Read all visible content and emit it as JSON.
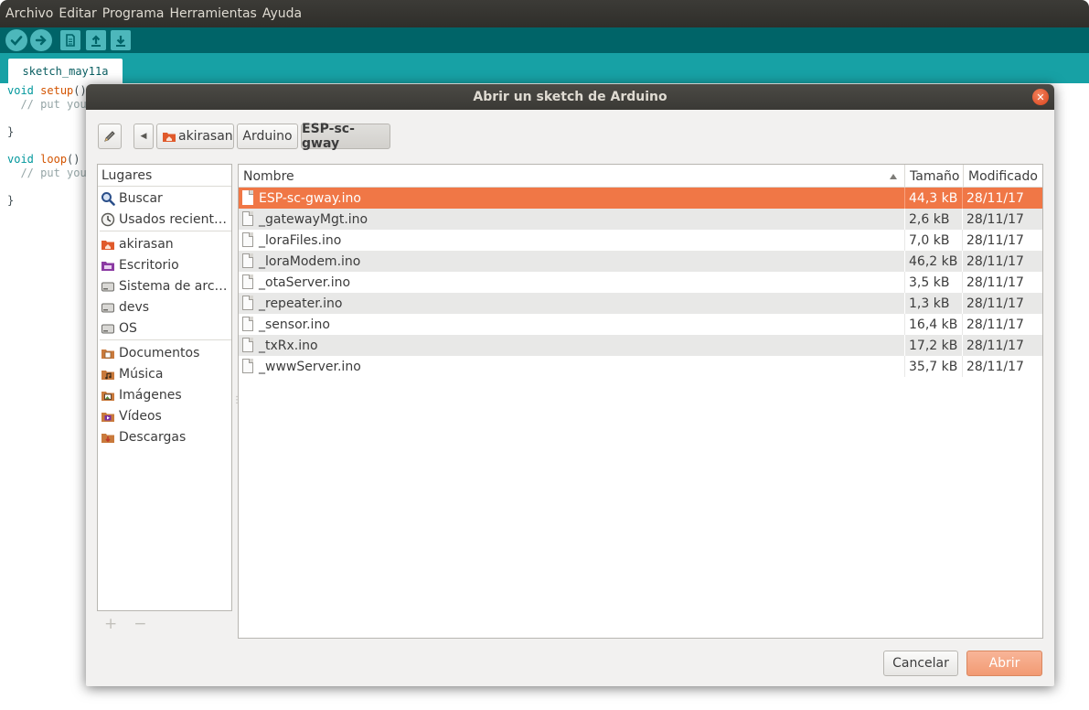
{
  "ide": {
    "menu": [
      "Archivo",
      "Editar",
      "Programa",
      "Herramientas",
      "Ayuda"
    ],
    "toolbar": {
      "verify_icon": "check-icon",
      "upload_icon": "arrow-right-icon",
      "new_icon": "new-file-icon",
      "open_icon": "arrow-up-icon",
      "save_icon": "arrow-down-icon"
    },
    "tab_label": "sketch_may11a",
    "code": {
      "l1_kw": "void",
      "l1_fn": "setup",
      "l1_rest": "()",
      "l2": "  // put you",
      "l3": "}",
      "l5_kw": "void",
      "l5_fn": "loop",
      "l5_rest": "() {",
      "l6": "  // put you",
      "l7": "}"
    },
    "colors": {
      "toolbar": "#006468",
      "tabbar": "#17a1a5"
    }
  },
  "dialog": {
    "title": "Abrir un sketch de Arduino",
    "close_icon": "close-icon",
    "path_edit_icon": "pencil-icon",
    "back_icon": "chevron-left-icon",
    "breadcrumbs": [
      "akirasan",
      "Arduino",
      "ESP-sc-gway"
    ],
    "places": {
      "header": "Lugares",
      "items": [
        {
          "label": "Buscar",
          "icon": "search-icon"
        },
        {
          "label": "Usados recient…",
          "icon": "recent-icon"
        },
        {
          "label": "akirasan",
          "icon": "home-folder-icon"
        },
        {
          "label": "Escritorio",
          "icon": "desktop-icon"
        },
        {
          "label": "Sistema de arc…",
          "icon": "drive-icon"
        },
        {
          "label": "devs",
          "icon": "drive-icon"
        },
        {
          "label": "OS",
          "icon": "drive-icon"
        },
        {
          "label": "Documentos",
          "icon": "documents-folder-icon"
        },
        {
          "label": "Música",
          "icon": "music-folder-icon"
        },
        {
          "label": "Imágenes",
          "icon": "pictures-folder-icon"
        },
        {
          "label": "Vídeos",
          "icon": "videos-folder-icon"
        },
        {
          "label": "Descargas",
          "icon": "downloads-folder-icon"
        }
      ],
      "add": "+",
      "remove": "−"
    },
    "files": {
      "columns": [
        "Nombre",
        "Tamaño",
        "Modificado"
      ],
      "sort_icon": "sort-ascending-icon",
      "rows": [
        {
          "name": "ESP-sc-gway.ino",
          "size": "44,3 kB",
          "date": "28/11/17"
        },
        {
          "name": "_gatewayMgt.ino",
          "size": "2,6 kB",
          "date": "28/11/17"
        },
        {
          "name": "_loraFiles.ino",
          "size": "7,0 kB",
          "date": "28/11/17"
        },
        {
          "name": "_loraModem.ino",
          "size": "46,2 kB",
          "date": "28/11/17"
        },
        {
          "name": "_otaServer.ino",
          "size": "3,5 kB",
          "date": "28/11/17"
        },
        {
          "name": "_repeater.ino",
          "size": "1,3 kB",
          "date": "28/11/17"
        },
        {
          "name": "_sensor.ino",
          "size": "16,4 kB",
          "date": "28/11/17"
        },
        {
          "name": "_txRx.ino",
          "size": "17,2 kB",
          "date": "28/11/17"
        },
        {
          "name": "_wwwServer.ino",
          "size": "35,7 kB",
          "date": "28/11/17"
        }
      ]
    },
    "buttons": {
      "cancel": "Cancelar",
      "open": "Abrir"
    },
    "colors": {
      "selection": "#f07746",
      "accent_button": "#f4a585"
    }
  }
}
